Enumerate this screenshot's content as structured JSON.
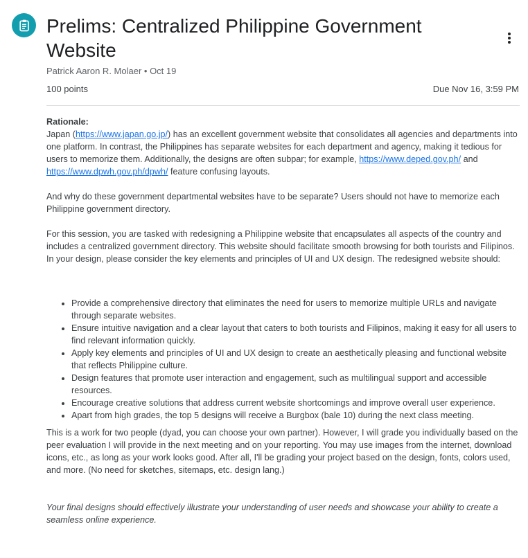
{
  "assignment": {
    "title": "Prelims: Centralized Philippine Government Website",
    "author": "Patrick Aaron R. Molaer",
    "separator": " • ",
    "posted_date": "Oct 19",
    "points": "100 points",
    "due": "Due Nov 16, 3:59 PM",
    "icon": "assignment-icon",
    "accent_color": "#129eaf"
  },
  "description": {
    "rationale_heading": "Rationale:",
    "p1_a": "Japan (",
    "link_japan": "https://www.japan.go.jp/",
    "p1_b": ") has an excellent government website that consolidates all agencies and departments into one platform. In contrast, the Philippines has separate websites for each department and agency, making it tedious for users to memorize them. Additionally, the designs are often subpar; for example, ",
    "link_deped": "https://www.deped.gov.ph/",
    "p1_and": " and ",
    "link_dpwh": "https://www.dpwh.gov.ph/dpwh/",
    "p1_c": " feature confusing layouts.",
    "p2": "And why do these government departmental websites have to be separate? Users should not have to memorize each Philippine government directory.",
    "p3": "For this session, you are tasked with redesigning a Philippine website that encapsulates all aspects of the country and includes a centralized government directory. This website should facilitate smooth browsing for both tourists and Filipinos. In your design, please consider the key elements and principles of UI and UX design. The redesigned website should:",
    "requirements": [
      "Provide a comprehensive directory that eliminates the need for users to memorize multiple URLs and navigate through separate websites.",
      "Ensure intuitive navigation and a clear layout that caters to both tourists and Filipinos, making it easy for all users to find relevant information quickly.",
      "Apply key elements and principles of UI and UX design to create an aesthetically pleasing and functional website that reflects Philippine culture.",
      "Design features that promote user interaction and engagement, such as multilingual support and accessible resources.",
      "Encourage creative solutions that address current website shortcomings and improve overall user experience.",
      " Apart from high grades, the top 5 designs will receive a Burgbox (bale 10) during the next class meeting."
    ],
    "p4": "This is a work for two people (dyad, you can choose your own partner). However, I will grade you individually based on the peer evaluation I will provide in the next meeting and on your reporting. You may use images from the internet, download icons, etc., as long as your work looks good. After all, I'll be grading your project based on the design, fonts, colors used, and more.  (No need for sketches, sitemaps, etc. design lang.)",
    "p5": "Your final designs should effectively illustrate your understanding of user needs and showcase your ability to create a seamless online experience."
  }
}
